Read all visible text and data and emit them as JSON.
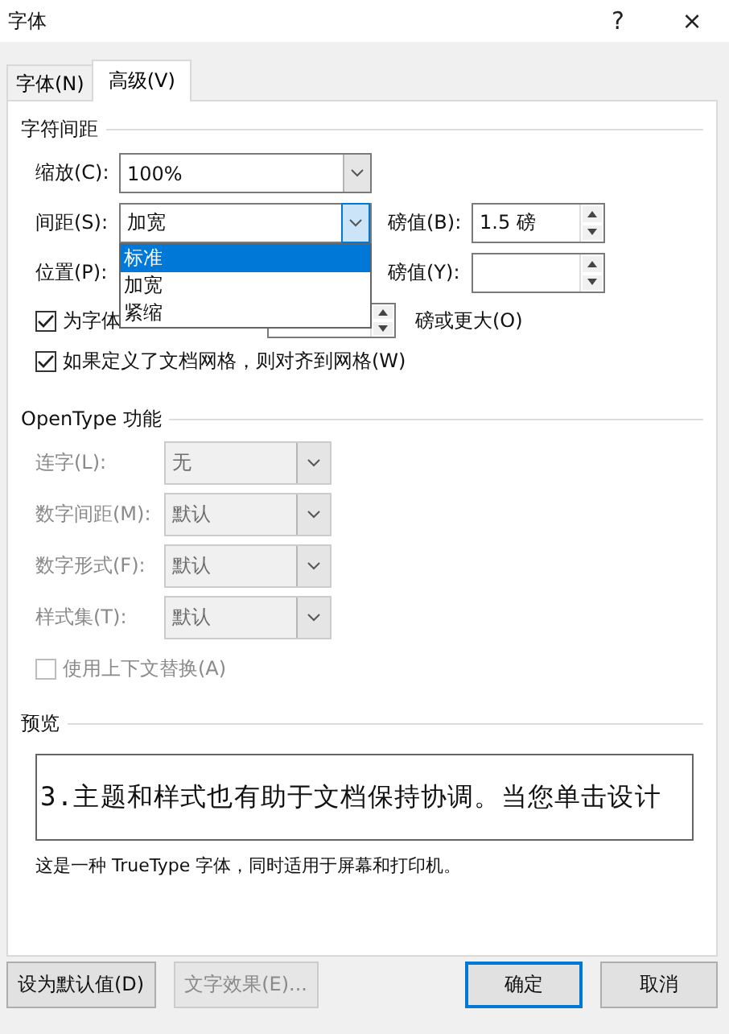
{
  "window": {
    "title": "字体",
    "help": "?",
    "close": "×"
  },
  "tabs": [
    {
      "label": "字体(N)",
      "selected": false
    },
    {
      "label": "高级(V)",
      "selected": true
    }
  ],
  "character_spacing": {
    "heading": "字符间距",
    "scale": {
      "label": "缩放(C):",
      "value": "100%"
    },
    "spacing": {
      "label": "间距(S):",
      "value": "加宽",
      "expanded": true,
      "by_label": "磅值(B):",
      "by_value": "1.5 磅",
      "options": [
        {
          "label": "标准",
          "highlighted": true
        },
        {
          "label": "加宽",
          "highlighted": false
        },
        {
          "label": "紧缩",
          "highlighted": false
        }
      ]
    },
    "position": {
      "label": "位置(P):",
      "by_label": "磅值(Y):"
    },
    "kerning": {
      "label": "为字体",
      "checked": true,
      "suffix": "磅或更大(O)"
    },
    "snap_to_grid": {
      "label": "如果定义了文档网格，则对齐到网格(W)",
      "checked": true
    }
  },
  "opentype": {
    "heading": "OpenType 功能",
    "fields": [
      {
        "label": "连字(L):",
        "value": "无",
        "disabled": true
      },
      {
        "label": "数字间距(M):",
        "value": "默认",
        "disabled": true
      },
      {
        "label": "数字形式(F):",
        "value": "默认",
        "disabled": true
      },
      {
        "label": "样式集(T):",
        "value": "默认",
        "disabled": true
      }
    ],
    "contextual": {
      "label": "使用上下文替换(A)",
      "checked": false,
      "disabled": true
    }
  },
  "preview": {
    "heading": "预览",
    "sample": "3.主题和样式也有助于文档保持协调。当您单击设计",
    "note": "这是一种 TrueType 字体，同时适用于屏幕和打印机。"
  },
  "left_buttons": [
    {
      "label": "设为默认值(D)",
      "disabled": false,
      "default": false
    },
    {
      "label": "文字效果(E)...",
      "disabled": true,
      "default": false
    }
  ],
  "right_buttons": [
    {
      "label": "确定",
      "disabled": false,
      "default": true
    },
    {
      "label": "取消",
      "disabled": false,
      "default": false
    }
  ]
}
